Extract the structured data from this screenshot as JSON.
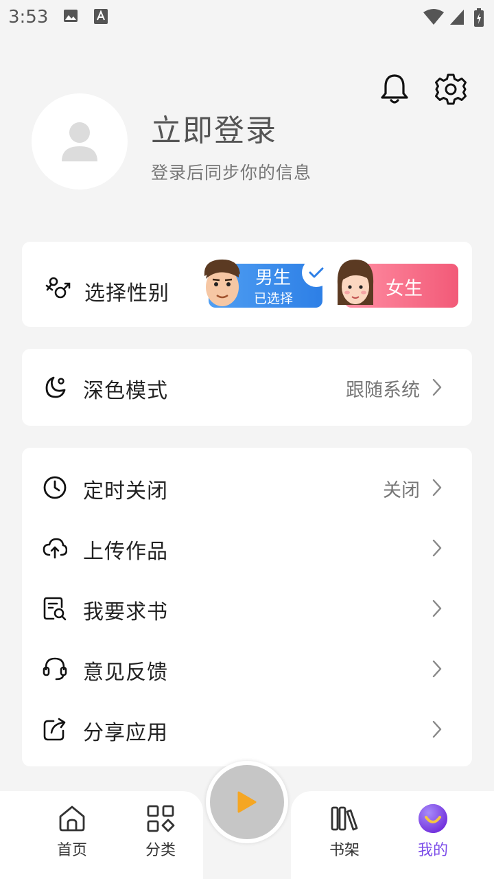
{
  "status_bar": {
    "time": "3:53"
  },
  "profile": {
    "title": "立即登录",
    "subtitle": "登录后同步你的信息"
  },
  "gender": {
    "label": "选择性别",
    "male": {
      "label": "男生",
      "sub": "已选择",
      "selected": true
    },
    "female": {
      "label": "女生",
      "selected": false
    }
  },
  "dark_mode": {
    "label": "深色模式",
    "value": "跟随系统"
  },
  "menu": [
    {
      "label": "定时关闭",
      "value": "关闭",
      "icon": "clock-icon"
    },
    {
      "label": "上传作品",
      "value": "",
      "icon": "cloud-upload-icon"
    },
    {
      "label": "我要求书",
      "value": "",
      "icon": "book-search-icon"
    },
    {
      "label": "意见反馈",
      "value": "",
      "icon": "headset-icon"
    },
    {
      "label": "分享应用",
      "value": "",
      "icon": "share-icon"
    }
  ],
  "bottom_nav": [
    {
      "label": "首页",
      "icon": "home-icon",
      "active": false
    },
    {
      "label": "分类",
      "icon": "category-icon",
      "active": false
    },
    {
      "label": "书架",
      "icon": "bookshelf-icon",
      "active": false
    },
    {
      "label": "我的",
      "icon": "profile-smile-icon",
      "active": true
    }
  ],
  "colors": {
    "accent": "#7a4ae8",
    "male": "#2d7fe6",
    "female": "#f25a78",
    "play_arrow": "#f5a623"
  }
}
